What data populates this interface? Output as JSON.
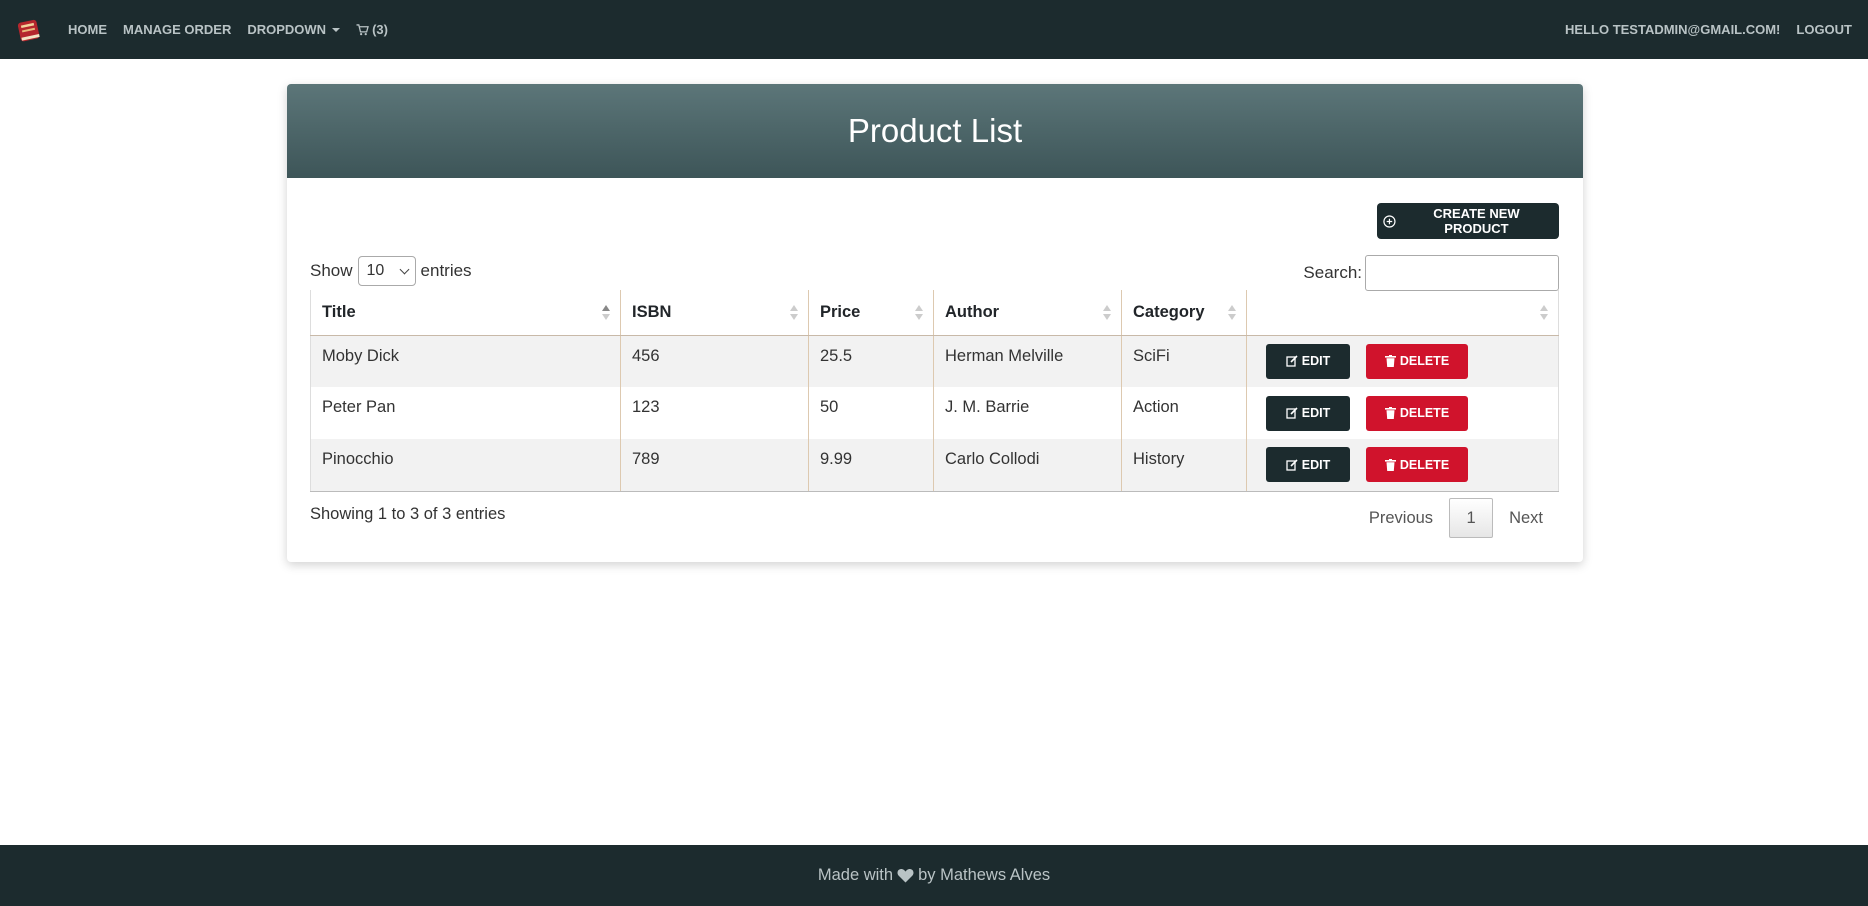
{
  "navbar": {
    "logo_icon": "book-icon",
    "home": "HOME",
    "manage_order": "MANAGE ORDER",
    "dropdown": "DROPDOWN",
    "cart_count": "(3)",
    "greeting": "HELLO TESTADMIN@GMAIL.COM!",
    "logout": "LOGOUT"
  },
  "page": {
    "title": "Product List",
    "create_button": "CREATE NEW PRODUCT",
    "length_prefix": "Show",
    "length_value": "10",
    "length_suffix": "entries",
    "search_label": "Search:",
    "search_value": ""
  },
  "table": {
    "columns": [
      "Title",
      "ISBN",
      "Price",
      "Author",
      "Category",
      ""
    ],
    "rows": [
      {
        "title": "Moby Dick",
        "isbn": "456",
        "price": "25.5",
        "author": "Herman Melville",
        "category": "SciFi"
      },
      {
        "title": "Peter Pan",
        "isbn": "123",
        "price": "50",
        "author": "J. M. Barrie",
        "category": "Action"
      },
      {
        "title": "Pinocchio",
        "isbn": "789",
        "price": "9.99",
        "author": "Carlo Collodi",
        "category": "History"
      }
    ],
    "edit_label": "EDIT",
    "delete_label": "DELETE"
  },
  "pagination": {
    "info": "Showing 1 to 3 of 3 entries",
    "previous": "Previous",
    "current": "1",
    "next": "Next"
  },
  "footer": {
    "made_with": "Made with",
    "by": "by Mathews Alves",
    "heart_icon": "heart-icon"
  },
  "colors": {
    "nav_bg": "#1c2b2e",
    "header_gradient_top": "#5c7679",
    "header_gradient_bottom": "#3d5558",
    "danger": "#d0132c"
  }
}
